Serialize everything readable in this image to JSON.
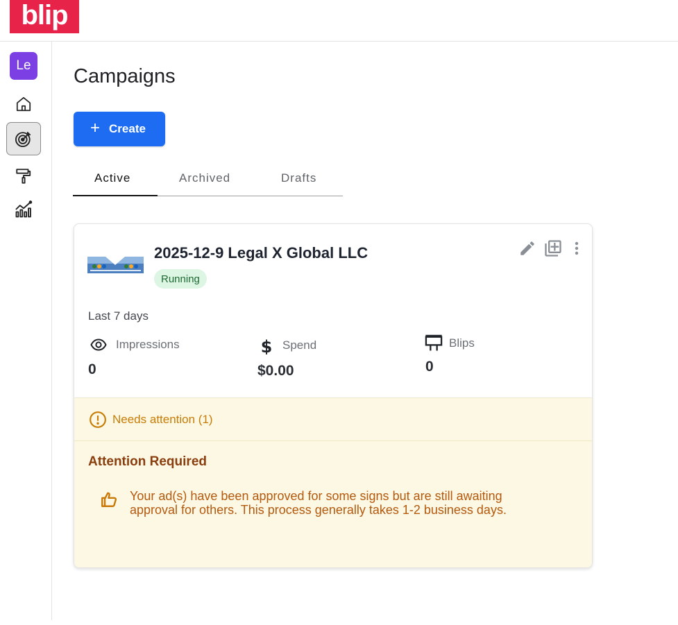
{
  "brand": {
    "logo_text": "blip",
    "color": "#e8234a"
  },
  "sidebar": {
    "avatar": "Le",
    "items": [
      {
        "name": "home",
        "icon": "home-icon"
      },
      {
        "name": "campaigns",
        "icon": "target-icon",
        "active": true
      },
      {
        "name": "creative",
        "icon": "paint-roller-icon"
      },
      {
        "name": "reports",
        "icon": "analytics-icon"
      }
    ]
  },
  "page": {
    "title": "Campaigns",
    "create_label": "Create"
  },
  "tabs": [
    {
      "label": "Active",
      "active": true
    },
    {
      "label": "Archived",
      "active": false
    },
    {
      "label": "Drafts",
      "active": false
    }
  ],
  "campaign": {
    "title": "2025-12-9 Legal X Global LLC",
    "status": "Running",
    "period": "Last 7 days",
    "metrics": {
      "impressions": {
        "label": "Impressions",
        "value": "0"
      },
      "spend": {
        "label": "Spend",
        "value": "$0.00"
      },
      "blips": {
        "label": "Blips",
        "value": "0"
      }
    },
    "attention": {
      "summary": "Needs attention (1)",
      "title": "Attention Required",
      "message": "Your ad(s) have been approved for some signs but are still awaiting approval for others. This process generally takes 1-2 business days."
    }
  },
  "colors": {
    "primary": "#1e6cf2",
    "avatar": "#7b3fe4",
    "running_bg": "#dcf6e3",
    "running_text": "#1f6a33",
    "attention_bg": "#fdf8e4",
    "attention_text": "#c77c05",
    "attention_title": "#8a3e0e"
  }
}
